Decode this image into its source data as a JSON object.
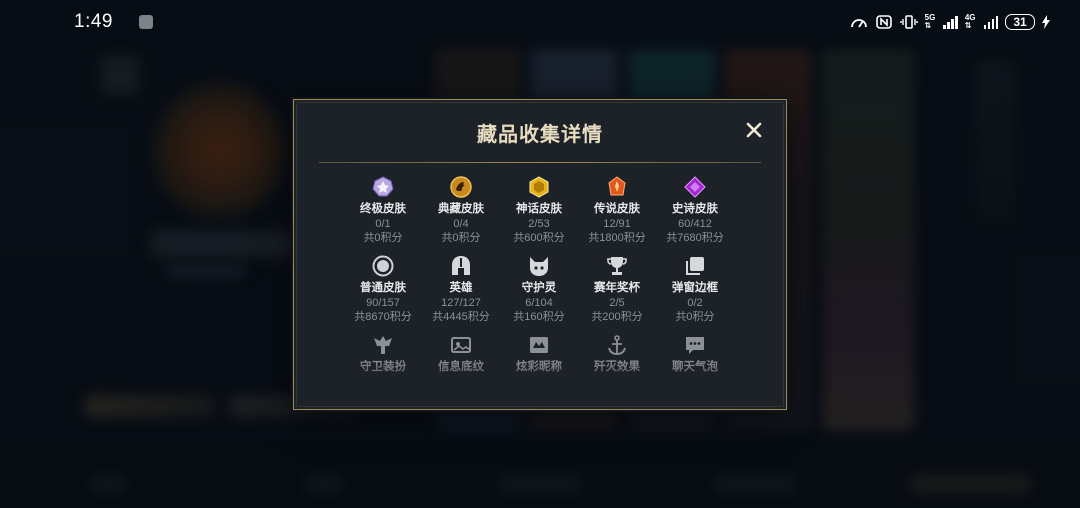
{
  "status_bar": {
    "time": "1:49",
    "net_1": "5G",
    "net_2": "4G",
    "battery": "31"
  },
  "modal": {
    "title": "藏品收集详情",
    "close_icon": "close-icon",
    "items": [
      {
        "name": "终极皮肤",
        "count": "0/1",
        "points": "共0积分",
        "icon": "ultimate-skin-icon"
      },
      {
        "name": "典藏皮肤",
        "count": "0/4",
        "points": "共0积分",
        "icon": "prestige-skin-icon"
      },
      {
        "name": "神话皮肤",
        "count": "2/53",
        "points": "共600积分",
        "icon": "mythic-skin-icon"
      },
      {
        "name": "传说皮肤",
        "count": "12/91",
        "points": "共1800积分",
        "icon": "legendary-skin-icon"
      },
      {
        "name": "史诗皮肤",
        "count": "60/412",
        "points": "共7680积分",
        "icon": "epic-skin-icon"
      },
      {
        "name": "普通皮肤",
        "count": "90/157",
        "points": "共8670积分",
        "icon": "normal-skin-icon"
      },
      {
        "name": "英雄",
        "count": "127/127",
        "points": "共4445积分",
        "icon": "champion-helmet-icon"
      },
      {
        "name": "守护灵",
        "count": "6/104",
        "points": "共160积分",
        "icon": "guardian-pet-icon"
      },
      {
        "name": "赛年奖杯",
        "count": "2/5",
        "points": "共200积分",
        "icon": "trophy-icon"
      },
      {
        "name": "弹窗边框",
        "count": "0/2",
        "points": "共0积分",
        "icon": "popup-frame-icon"
      },
      {
        "name": "守卫装扮",
        "icon": "ward-skin-icon"
      },
      {
        "name": "信息底纹",
        "icon": "info-banner-icon"
      },
      {
        "name": "炫彩昵称",
        "icon": "colorful-nickname-icon"
      },
      {
        "name": "歼灭效果",
        "icon": "ace-effect-icon"
      },
      {
        "name": "聊天气泡",
        "icon": "chat-bubble-icon"
      }
    ]
  },
  "colors": {
    "modal_bg": "#1c2228",
    "modal_border": "#a08a54",
    "title": "#e7dcc0",
    "text_primary": "#e6e8ea",
    "text_secondary": "#8b9196"
  }
}
